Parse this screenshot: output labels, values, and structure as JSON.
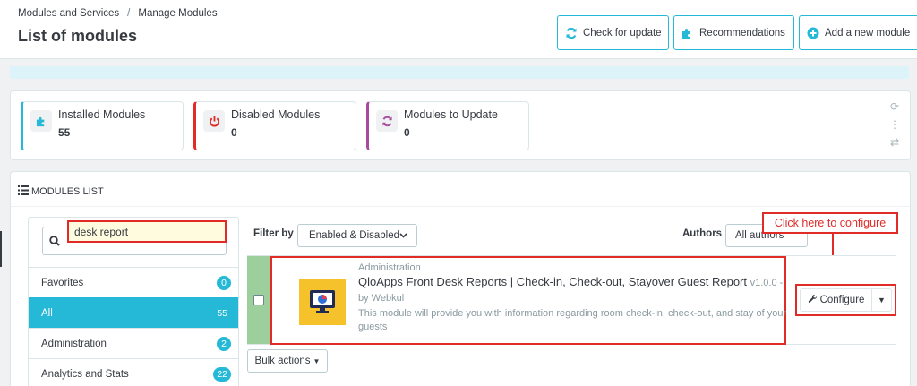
{
  "breadcrumb": {
    "parent": "Modules and Services",
    "separator": "/",
    "current": "Manage Modules"
  },
  "page_title": "List of modules",
  "toolbar": {
    "check_update": "Check for update",
    "recommendations": "Recommendations",
    "add_module": "Add a new module"
  },
  "kpis": [
    {
      "label": "Installed Modules",
      "value": "55",
      "color": "#25b9d7",
      "icon": "puzzle-icon"
    },
    {
      "label": "Disabled Modules",
      "value": "0",
      "color": "#e02b27",
      "icon": "power-icon"
    },
    {
      "label": "Modules to Update",
      "value": "0",
      "color": "#a84b9e",
      "icon": "refresh-icon"
    }
  ],
  "modules_list": {
    "title": "MODULES LIST",
    "search": {
      "value": "desk report"
    },
    "categories": [
      {
        "label": "Favorites",
        "count": "0",
        "active": false
      },
      {
        "label": "All",
        "count": "55",
        "active": true
      },
      {
        "label": "Administration",
        "count": "2",
        "active": false
      },
      {
        "label": "Analytics and Stats",
        "count": "22",
        "active": false
      }
    ],
    "filter": {
      "label": "Filter by",
      "value": "Enabled & Disabled"
    },
    "authors": {
      "label": "Authors",
      "value": "All authors"
    },
    "callout": "Click here to configure",
    "module": {
      "category": "Administration",
      "name": "QloApps Front Desk Reports | Check-in, Check-out, Stayover Guest Report",
      "version": "v1.0.0 -",
      "author": "by Webkul",
      "description": "This module will provide you with information regarding room check-in, check-out, and stay of your guests",
      "configure_label": "Configure"
    },
    "bulk_actions": "Bulk actions"
  },
  "colors": {
    "accent": "#25b9d7",
    "danger": "#e02b27",
    "enabled": "#9ccf9c",
    "logo_bg": "#f5c22b"
  }
}
